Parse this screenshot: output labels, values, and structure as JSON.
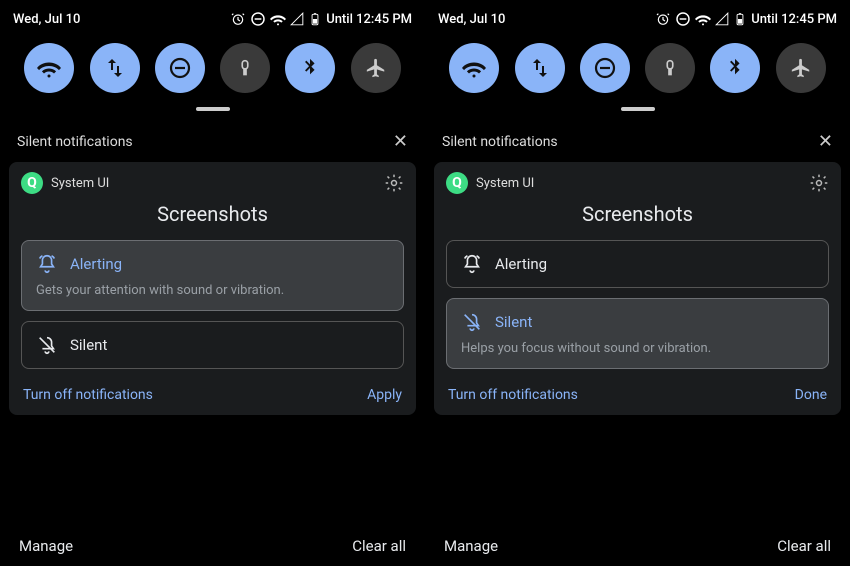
{
  "panels": [
    {
      "status": {
        "date": "Wed, Jul 10",
        "battery_text": "Until 12:45 PM"
      },
      "silent_header": "Silent notifications",
      "app_name": "System UI",
      "card_title": "Screenshots",
      "alerting": {
        "label": "Alerting",
        "desc": "Gets your attention with sound or vibration."
      },
      "silent": {
        "label": "Silent"
      },
      "turn_off": "Turn off notifications",
      "confirm": "Apply",
      "manage": "Manage",
      "clear": "Clear all"
    },
    {
      "status": {
        "date": "Wed, Jul 10",
        "battery_text": "Until 12:45 PM"
      },
      "silent_header": "Silent notifications",
      "app_name": "System UI",
      "card_title": "Screenshots",
      "alerting": {
        "label": "Alerting"
      },
      "silent": {
        "label": "Silent",
        "desc": "Helps you focus without sound or vibration."
      },
      "turn_off": "Turn off notifications",
      "confirm": "Done",
      "manage": "Manage",
      "clear": "Clear all"
    }
  ]
}
